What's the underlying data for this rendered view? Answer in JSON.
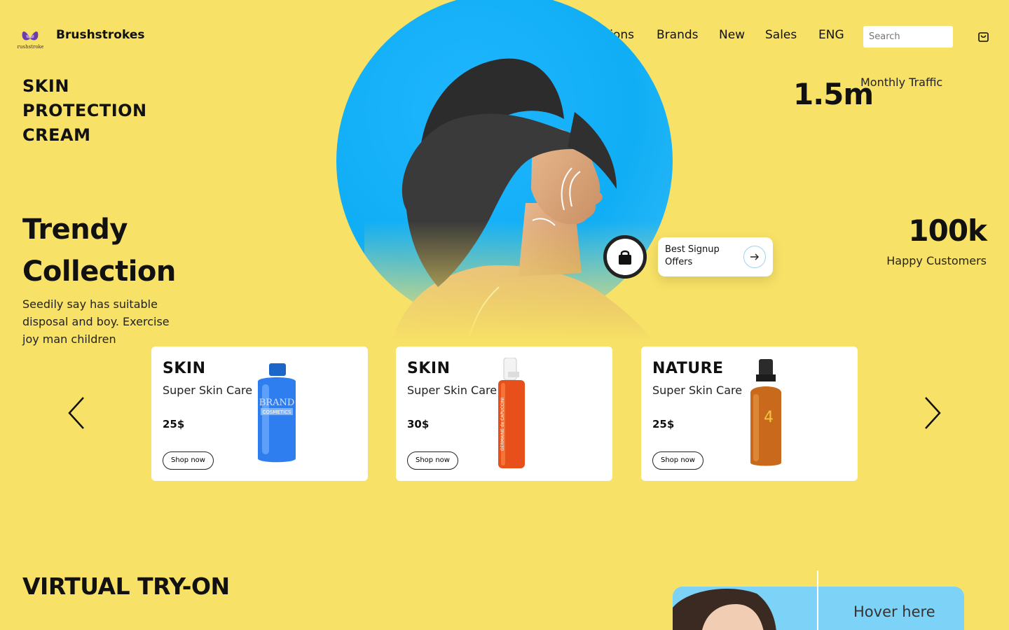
{
  "header": {
    "brand": "Brushstrokes",
    "logo_text": "Brushstrokes",
    "nav": [
      "Collections",
      "Brands",
      "New",
      "Sales",
      "ENG"
    ],
    "search_placeholder": "Search"
  },
  "hero": {
    "tagline_lines": [
      "SKIN",
      "PROTECTION",
      "CREAM"
    ],
    "title_lines": [
      "Trendy",
      "Collection"
    ],
    "description": "Seedily say has suitable disposal and boy. Exercise joy man children"
  },
  "stats": [
    {
      "value": "1.5m",
      "label": "Monthly Traffic"
    },
    {
      "value": "100k",
      "label": "Happy Customers"
    }
  ],
  "signup": {
    "label": "Best Signup Offers"
  },
  "products": [
    {
      "category": "SKIN",
      "name": "Super Skin Care",
      "price": "25$",
      "button": "Shop now",
      "bottle_text": [
        "BRAND",
        "COSMETICS"
      ]
    },
    {
      "category": "SKIN",
      "name": "Super Skin Care",
      "price": "30$",
      "button": "Shop now",
      "bottle_text": [
        "GERMAINE de CAPUCCINI"
      ]
    },
    {
      "category": "NATURE",
      "name": "Super Skin Care",
      "price": "25$",
      "button": "Shop now",
      "bottle_text": [
        "4"
      ]
    }
  ],
  "virtual_tryon": {
    "title": "VIRTUAL TRY-ON",
    "hover_label": "Hover here"
  },
  "colors": {
    "background": "#f7e166",
    "accent_blue": "#10aef5",
    "text": "#111111"
  }
}
